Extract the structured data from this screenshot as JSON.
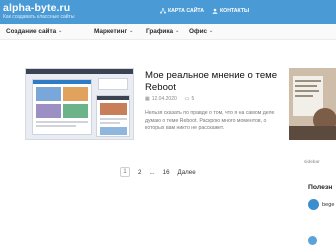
{
  "site": {
    "title": "alpha-byte.ru",
    "tagline": "Как создавать классные сайты"
  },
  "header_nav": [
    {
      "label": "КАРТА САЙТА",
      "icon": "sitemap-icon"
    },
    {
      "label": "КОНТАКТЫ",
      "icon": "contacts-icon"
    }
  ],
  "menu": [
    {
      "label": "Создание сайта"
    },
    {
      "label": "Маркетинг"
    },
    {
      "label": "Графика"
    },
    {
      "label": "Офис"
    }
  ],
  "article": {
    "title": "Мое реальное мнение о теме Reboot",
    "date": "12.04.2020",
    "comments": "5",
    "excerpt": "Нельзя сказать по правде о том, что я на самом деле думаю о теме Reboot. Раскрою много моментов, о которых вам никто не расскажет."
  },
  "sidebar": {
    "link_text": "sidebar",
    "heading": "Полезн",
    "item_name": "bege"
  },
  "pagination": {
    "current": "1",
    "next": "2",
    "ellipsis": "...",
    "last": "16",
    "forward": "Далее"
  },
  "colors": {
    "header_bg": "#4a9ad6",
    "text_dark": "#111111",
    "muted": "#8a8a8a"
  }
}
